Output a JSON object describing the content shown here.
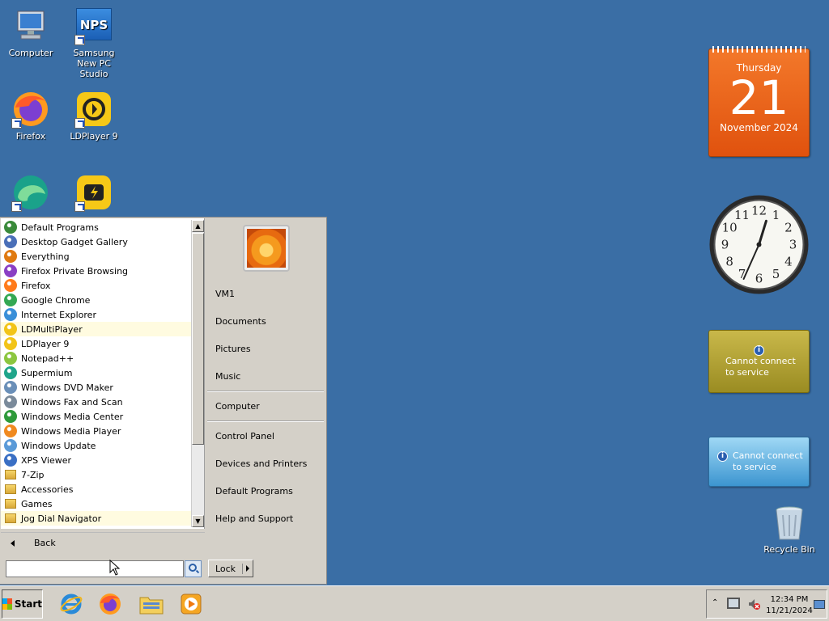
{
  "desktop": {
    "icons": [
      {
        "label": "Computer"
      },
      {
        "label": "Samsung New PC Studio",
        "badge": "NPS"
      },
      {
        "label": "Firefox"
      },
      {
        "label": "LDPlayer 9"
      }
    ],
    "recycle_bin": "Recycle Bin"
  },
  "start_menu": {
    "programs": [
      {
        "label": "Default Programs",
        "icon": "default-programs-icon",
        "color": "#3a8a3a"
      },
      {
        "label": "Desktop Gadget Gallery",
        "icon": "gadget-gallery-icon",
        "color": "#4a6fb8"
      },
      {
        "label": "Everything",
        "icon": "everything-icon",
        "color": "#e07a10"
      },
      {
        "label": "Firefox Private Browsing",
        "icon": "firefox-private-icon",
        "color": "#8a3fc4"
      },
      {
        "label": "Firefox",
        "icon": "firefox-icon",
        "color": "#ff7a1a"
      },
      {
        "label": "Google Chrome",
        "icon": "chrome-icon",
        "color": "#34a853"
      },
      {
        "label": "Internet Explorer",
        "icon": "ie-icon",
        "color": "#3a8fd8"
      },
      {
        "label": "LDMultiPlayer",
        "icon": "ldmultiplayer-icon",
        "color": "#f2c418",
        "highlight": true
      },
      {
        "label": "LDPlayer 9",
        "icon": "ldplayer-icon",
        "color": "#f2c418"
      },
      {
        "label": "Notepad++",
        "icon": "notepadpp-icon",
        "color": "#8cc63f"
      },
      {
        "label": "Supermium",
        "icon": "supermium-icon",
        "color": "#1fa58a"
      },
      {
        "label": "Windows DVD Maker",
        "icon": "dvd-maker-icon",
        "color": "#6a8fb8"
      },
      {
        "label": "Windows Fax and Scan",
        "icon": "fax-scan-icon",
        "color": "#7a8a9a"
      },
      {
        "label": "Windows Media Center",
        "icon": "media-center-icon",
        "color": "#2e9a3a"
      },
      {
        "label": "Windows Media Player",
        "icon": "media-player-icon",
        "color": "#f08a20"
      },
      {
        "label": "Windows Update",
        "icon": "windows-update-icon",
        "color": "#5a9ad8"
      },
      {
        "label": "XPS Viewer",
        "icon": "xps-viewer-icon",
        "color": "#3a6fc4"
      },
      {
        "label": "7-Zip",
        "icon": "folder-icon",
        "folder": true
      },
      {
        "label": "Accessories",
        "icon": "folder-icon",
        "folder": true
      },
      {
        "label": "Games",
        "icon": "folder-icon",
        "folder": true
      },
      {
        "label": "Jog Dial Navigator",
        "icon": "folder-icon",
        "folder": true,
        "highlight": true
      }
    ],
    "back_label": "Back",
    "search_value": "",
    "right_items": [
      {
        "label": "VM1"
      },
      {
        "label": "Documents"
      },
      {
        "label": "Pictures"
      },
      {
        "label": "Music"
      },
      {
        "label": "Computer"
      },
      {
        "label": "Control Panel"
      },
      {
        "label": "Devices and Printers"
      },
      {
        "label": "Default Programs"
      },
      {
        "label": "Help and Support"
      }
    ],
    "lock_label": "Lock"
  },
  "gadgets": {
    "calendar": {
      "weekday": "Thursday",
      "day": "21",
      "month_year": "November 2024"
    },
    "clock": {
      "hour": 12,
      "minute": 34
    },
    "feed_message": "Cannot connect to service",
    "weather_message": "Cannot connect to service"
  },
  "taskbar": {
    "start_label": "Start",
    "time": "12:34 PM",
    "date": "11/21/2024"
  }
}
